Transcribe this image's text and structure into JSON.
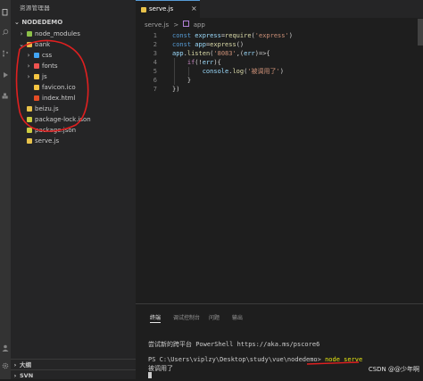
{
  "sidebar": {
    "title": "资源管理器",
    "project": "NODEDEMO",
    "tree": [
      {
        "label": "node_modules",
        "kind": "folder",
        "depth": 0,
        "expanded": false,
        "color": "#8dc149"
      },
      {
        "label": "bank",
        "kind": "folder",
        "depth": 0,
        "expanded": true,
        "color": "#e8b94a"
      },
      {
        "label": "css",
        "kind": "folder",
        "depth": 1,
        "expanded": false,
        "color": "#42a5f5"
      },
      {
        "label": "fonts",
        "kind": "folder",
        "depth": 1,
        "expanded": false,
        "color": "#ef5350"
      },
      {
        "label": "js",
        "kind": "folder",
        "depth": 1,
        "expanded": false,
        "color": "#f5c542"
      },
      {
        "label": "favicon.ico",
        "kind": "file",
        "depth": 1,
        "color": "#f5c542"
      },
      {
        "label": "index.html",
        "kind": "file",
        "depth": 1,
        "color": "#e44d26"
      },
      {
        "label": "beizu.js",
        "kind": "file",
        "depth": 0,
        "color": "#e8c24a"
      },
      {
        "label": "package-lock.json",
        "kind": "file",
        "depth": 0,
        "color": "#cbcb41"
      },
      {
        "label": "package.json",
        "kind": "file",
        "depth": 0,
        "color": "#cbcb41"
      },
      {
        "label": "serve.js",
        "kind": "file",
        "depth": 0,
        "color": "#e8c24a"
      }
    ],
    "outline_label": "大纲",
    "svn_label": "SVN"
  },
  "editor": {
    "tab_label": "serve.js",
    "tab_close": "×",
    "breadcrumb_file": "serve.js",
    "breadcrumb_sep": ">",
    "breadcrumb_symbol": "app",
    "lines": [
      [
        [
          "kw",
          "const "
        ],
        [
          "id",
          "express"
        ],
        [
          "pn",
          "="
        ],
        [
          "fn",
          "require"
        ],
        [
          "pn",
          "("
        ],
        [
          "str",
          "'express'"
        ],
        [
          "pn",
          ")"
        ]
      ],
      [
        [
          "kw",
          "const "
        ],
        [
          "id",
          "app"
        ],
        [
          "pn",
          "="
        ],
        [
          "fn",
          "express"
        ],
        [
          "pn",
          "()"
        ]
      ],
      [
        [
          "id",
          "app"
        ],
        [
          "pn",
          "."
        ],
        [
          "fn",
          "listen"
        ],
        [
          "pn",
          "("
        ],
        [
          "str",
          "'8083'"
        ],
        [
          "pn",
          ",("
        ],
        [
          "id",
          "err"
        ],
        [
          "pn",
          ")=>{"
        ]
      ],
      [
        [
          "pn",
          "    "
        ],
        [
          "kw2",
          "if"
        ],
        [
          "pn",
          "(!"
        ],
        [
          "id",
          "err"
        ],
        [
          "pn",
          "){"
        ]
      ],
      [
        [
          "pn",
          "        "
        ],
        [
          "id",
          "console"
        ],
        [
          "pn",
          "."
        ],
        [
          "fn",
          "log"
        ],
        [
          "pn",
          "("
        ],
        [
          "str",
          "'被调用了'"
        ],
        [
          "pn",
          ")"
        ]
      ],
      [
        [
          "pn",
          "    }"
        ]
      ],
      [
        [
          "pn",
          "})"
        ]
      ]
    ]
  },
  "panel": {
    "tabs": [
      "终端",
      "调试控制台",
      "问题",
      "输出"
    ],
    "active_tab": "终端",
    "lines": {
      "notice": "尝试新的跨平台 PowerShell https://aka.ms/pscore6",
      "prompt": "PS C:\\Users\\viplzy\\Desktop\\study\\vue\\nodedemo> ",
      "command": "node serve",
      "output": "被调用了"
    }
  },
  "watermark": "CSDN @@少年啊",
  "colors": {
    "annotation": "#e02020",
    "accent": "#569cd6"
  }
}
